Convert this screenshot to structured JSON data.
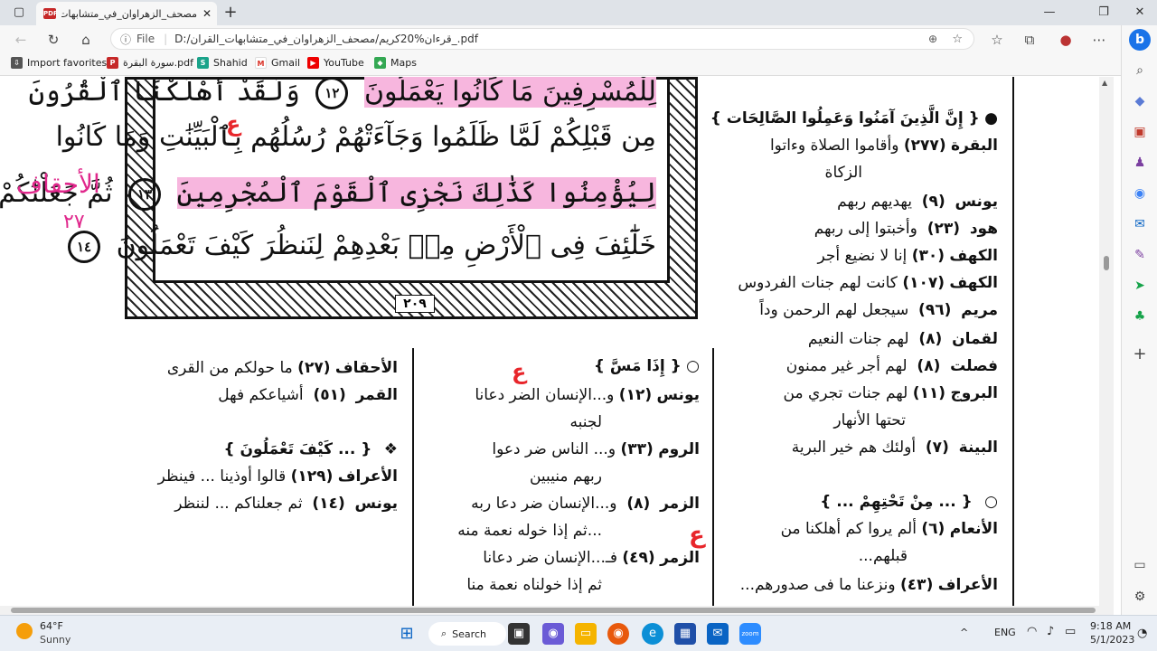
{
  "browser": {
    "tab_title": "مصحف_الزهراوان_في_متشابهات_ا...",
    "url_prefix": "File",
    "url": "D:/قرءان%20كريم/مصحف_الزهراوان_في_متشابهات_القران_.pdf",
    "favorites": [
      {
        "label": "Import favorites",
        "icon": "import-icon"
      },
      {
        "label": "سورة البقرة.pdf",
        "icon": "pdf-icon"
      },
      {
        "label": "Shahid",
        "icon": "shahid-icon"
      },
      {
        "label": "Gmail",
        "icon": "gmail-icon"
      },
      {
        "label": "YouTube",
        "icon": "youtube-icon"
      },
      {
        "label": "Maps",
        "icon": "maps-icon"
      }
    ]
  },
  "quran": {
    "lines": [
      "لِلْمُسْرِفِينَ مَا كَانُوا يَعْمَلُونَ",
      "وَلَقَدْ أَهْلَكْنَا ٱلْقُرُونَ",
      "مِن قَبْلِكُمْ لَمَّا ظَلَمُوا وَجَآءَتْهُمْ رُسُلُهُم بِٱلْبَيِّنَٰتِ وَمَا كَانُوا",
      "لِيُؤْمِنُوا كَذَٰلِكَ نَجْزِى ٱلْقَوْمَ ٱلْمُجْرِمِينَ",
      "ثُمَّ جَعَلْنَٰكُمْ",
      "خَلَٰٓئِفَ فِى ٱلْأَرْضِ مِنۢ بَعْدِهِمْ لِنَنظُرَ كَيْفَ تَعْمَلُونَ"
    ],
    "ayah_12": "١٢",
    "ayah_13": "١٣",
    "ayah_14": "١٤",
    "page_number": "٢٠٩"
  },
  "index_right": {
    "heading": "{ إِنَّ الَّذِينَ آمَنُوا وَعَمِلُوا الصَّالِحَات }",
    "rows": [
      {
        "sura": "البقرة",
        "num": "(٢٧٧)",
        "text": "وأقاموا الصلاة وءاتوا"
      },
      {
        "sura": "",
        "num": "",
        "text": "الزكاة"
      },
      {
        "sura": "يونس",
        "num": "(٩)",
        "text": "يهديهم ربهم"
      },
      {
        "sura": "هود",
        "num": "(٢٣)",
        "text": "وأخبتوا إلى ربهم"
      },
      {
        "sura": "الكهف",
        "num": "(٣٠)",
        "text": "إنا لا نضيع أجر"
      },
      {
        "sura": "الكهف",
        "num": "(١٠٧)",
        "text": "كانت لهم جنات الفردوس"
      },
      {
        "sura": "مريم",
        "num": "(٩٦)",
        "text": "سيجعل لهم الرحمن وداً"
      },
      {
        "sura": "لقمان",
        "num": "(٨)",
        "text": "لهم جنات النعيم"
      },
      {
        "sura": "فصلت",
        "num": "(٨)",
        "text": "لهم أجر غير ممنون"
      },
      {
        "sura": "البروج",
        "num": "(١١)",
        "text": "لهم جنات تجري من"
      },
      {
        "sura": "",
        "num": "",
        "text": "تحتها الأنهار"
      },
      {
        "sura": "البينة",
        "num": "(٧)",
        "text": "أولئك هم خير البرية"
      }
    ],
    "heading2": "{ ... مِنْ تَحْتِهِمْ ... }",
    "rows2": [
      {
        "sura": "الأنعام",
        "num": "(٦)",
        "text": "ألم يروا كم أهلكنا من"
      },
      {
        "sura": "",
        "num": "",
        "text": "قبلهم..."
      },
      {
        "sura": "الأعراف",
        "num": "(٤٣)",
        "text": "ونزعنا ما فى صدورهم..."
      }
    ]
  },
  "index_middle": {
    "heading": "{ إِذَا مَسَّ }",
    "rows": [
      {
        "sura": "يونس",
        "num": "(١٢)",
        "text": "و...الإنسان الضر دعانا"
      },
      {
        "sura": "",
        "num": "",
        "text": "لجنبه"
      },
      {
        "sura": "الروم",
        "num": "(٣٣)",
        "text": "و... الناس ضر دعوا"
      },
      {
        "sura": "",
        "num": "",
        "text": "ربهم منيبين"
      },
      {
        "sura": "الزمر",
        "num": "(٨)",
        "text": "و...الإنسان ضر دعا ربه"
      },
      {
        "sura": "",
        "num": "",
        "text": "...ثم إذا خوله نعمة منه"
      },
      {
        "sura": "الزمر",
        "num": "(٤٩)",
        "text": "فـ...الإنسان ضر دعانا"
      },
      {
        "sura": "",
        "num": "",
        "text": "ثم إذا خولناه نعمة منا"
      }
    ]
  },
  "index_left": {
    "rows": [
      {
        "sura": "الأحقاف",
        "num": "(٢٧)",
        "text": "ما حولكم من القرى"
      },
      {
        "sura": "القمر",
        "num": "(٥١)",
        "text": "أشياعكم فهل"
      }
    ],
    "heading": "{ ... كَيْفَ تَعْمَلُونَ }",
    "rows2": [
      {
        "sura": "الأعراف",
        "num": "(١٢٩)",
        "text": "قالوا أوذينا ... فينظر"
      },
      {
        "sura": "يونس",
        "num": "(١٤)",
        "text": "ثم جعلناكم ... لننظر"
      }
    ]
  },
  "annotations": {
    "pink_word": "الأحقاف",
    "pink_num": "٢٧"
  },
  "taskbar": {
    "weather_temp": "64°F",
    "weather_desc": "Sunny",
    "search_label": "Search",
    "lang": "ENG",
    "time": "9:18 AM",
    "date": "5/1/2023"
  }
}
